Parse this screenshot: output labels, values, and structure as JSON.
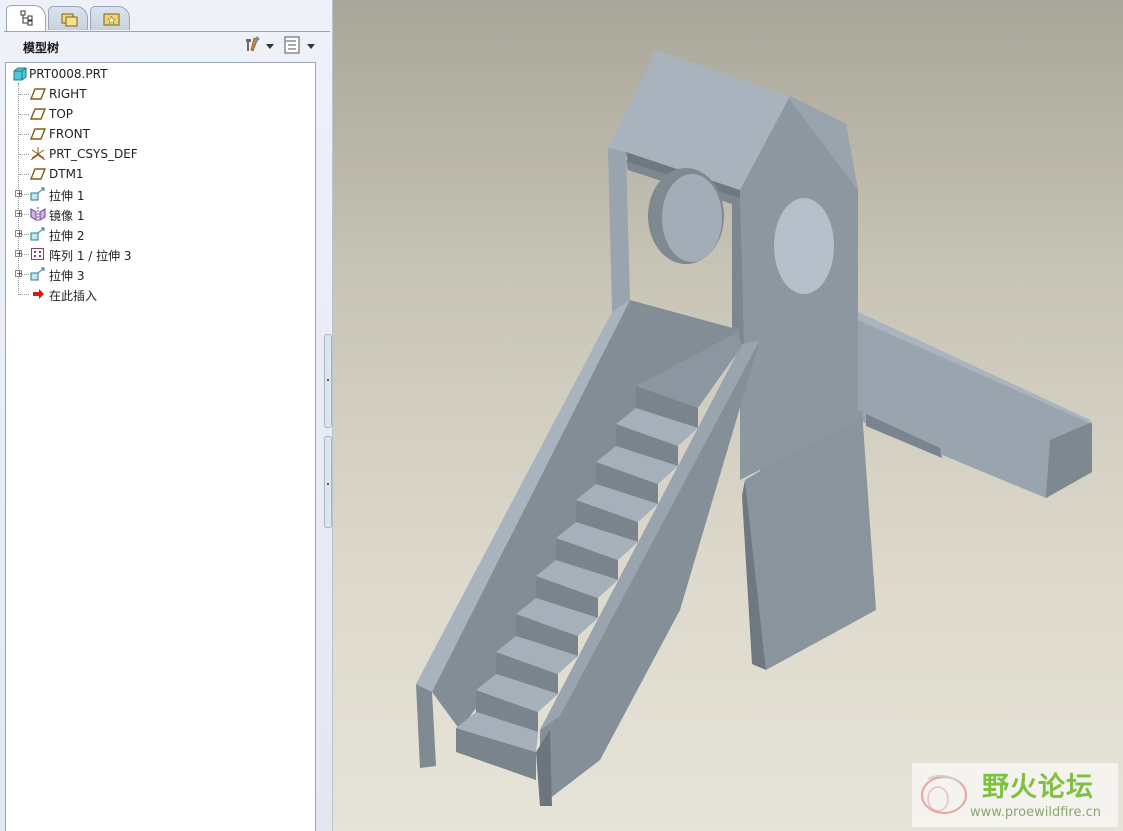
{
  "model_tree": {
    "title": "模型树",
    "root": "PRT0008.PRT",
    "items": [
      {
        "label": "RIGHT",
        "icon": "datum-plane-icon",
        "expandable": false
      },
      {
        "label": "TOP",
        "icon": "datum-plane-icon",
        "expandable": false
      },
      {
        "label": "FRONT",
        "icon": "datum-plane-icon",
        "expandable": false
      },
      {
        "label": "PRT_CSYS_DEF",
        "icon": "coordinate-system-icon",
        "expandable": false
      },
      {
        "label": "DTM1",
        "icon": "datum-plane-icon",
        "expandable": false
      },
      {
        "label": "拉伸 1",
        "icon": "extrude-icon",
        "expandable": true
      },
      {
        "label": "镜像 1",
        "icon": "mirror-icon",
        "expandable": true
      },
      {
        "label": "拉伸 2",
        "icon": "extrude-icon",
        "expandable": true
      },
      {
        "label": "阵列 1 / 拉伸 3",
        "icon": "pattern-icon",
        "expandable": true
      },
      {
        "label": "拉伸 3",
        "icon": "extrude-icon",
        "expandable": true
      },
      {
        "label": "在此插入",
        "icon": "insert-here-arrow-icon",
        "expandable": false
      }
    ]
  },
  "tabs": [
    {
      "name": "model-tree-tab",
      "icon": "tree-icon"
    },
    {
      "name": "folder-browser-tab",
      "icon": "folders-icon"
    },
    {
      "name": "favorites-tab",
      "icon": "favorites-folder-icon"
    }
  ],
  "watermark": {
    "title": "野火论坛",
    "url": "www.proewildfire.cn"
  },
  "colors": {
    "accent_green": "#7fc040",
    "model_light": "#a9b4bf",
    "model_dark": "#818b94"
  }
}
